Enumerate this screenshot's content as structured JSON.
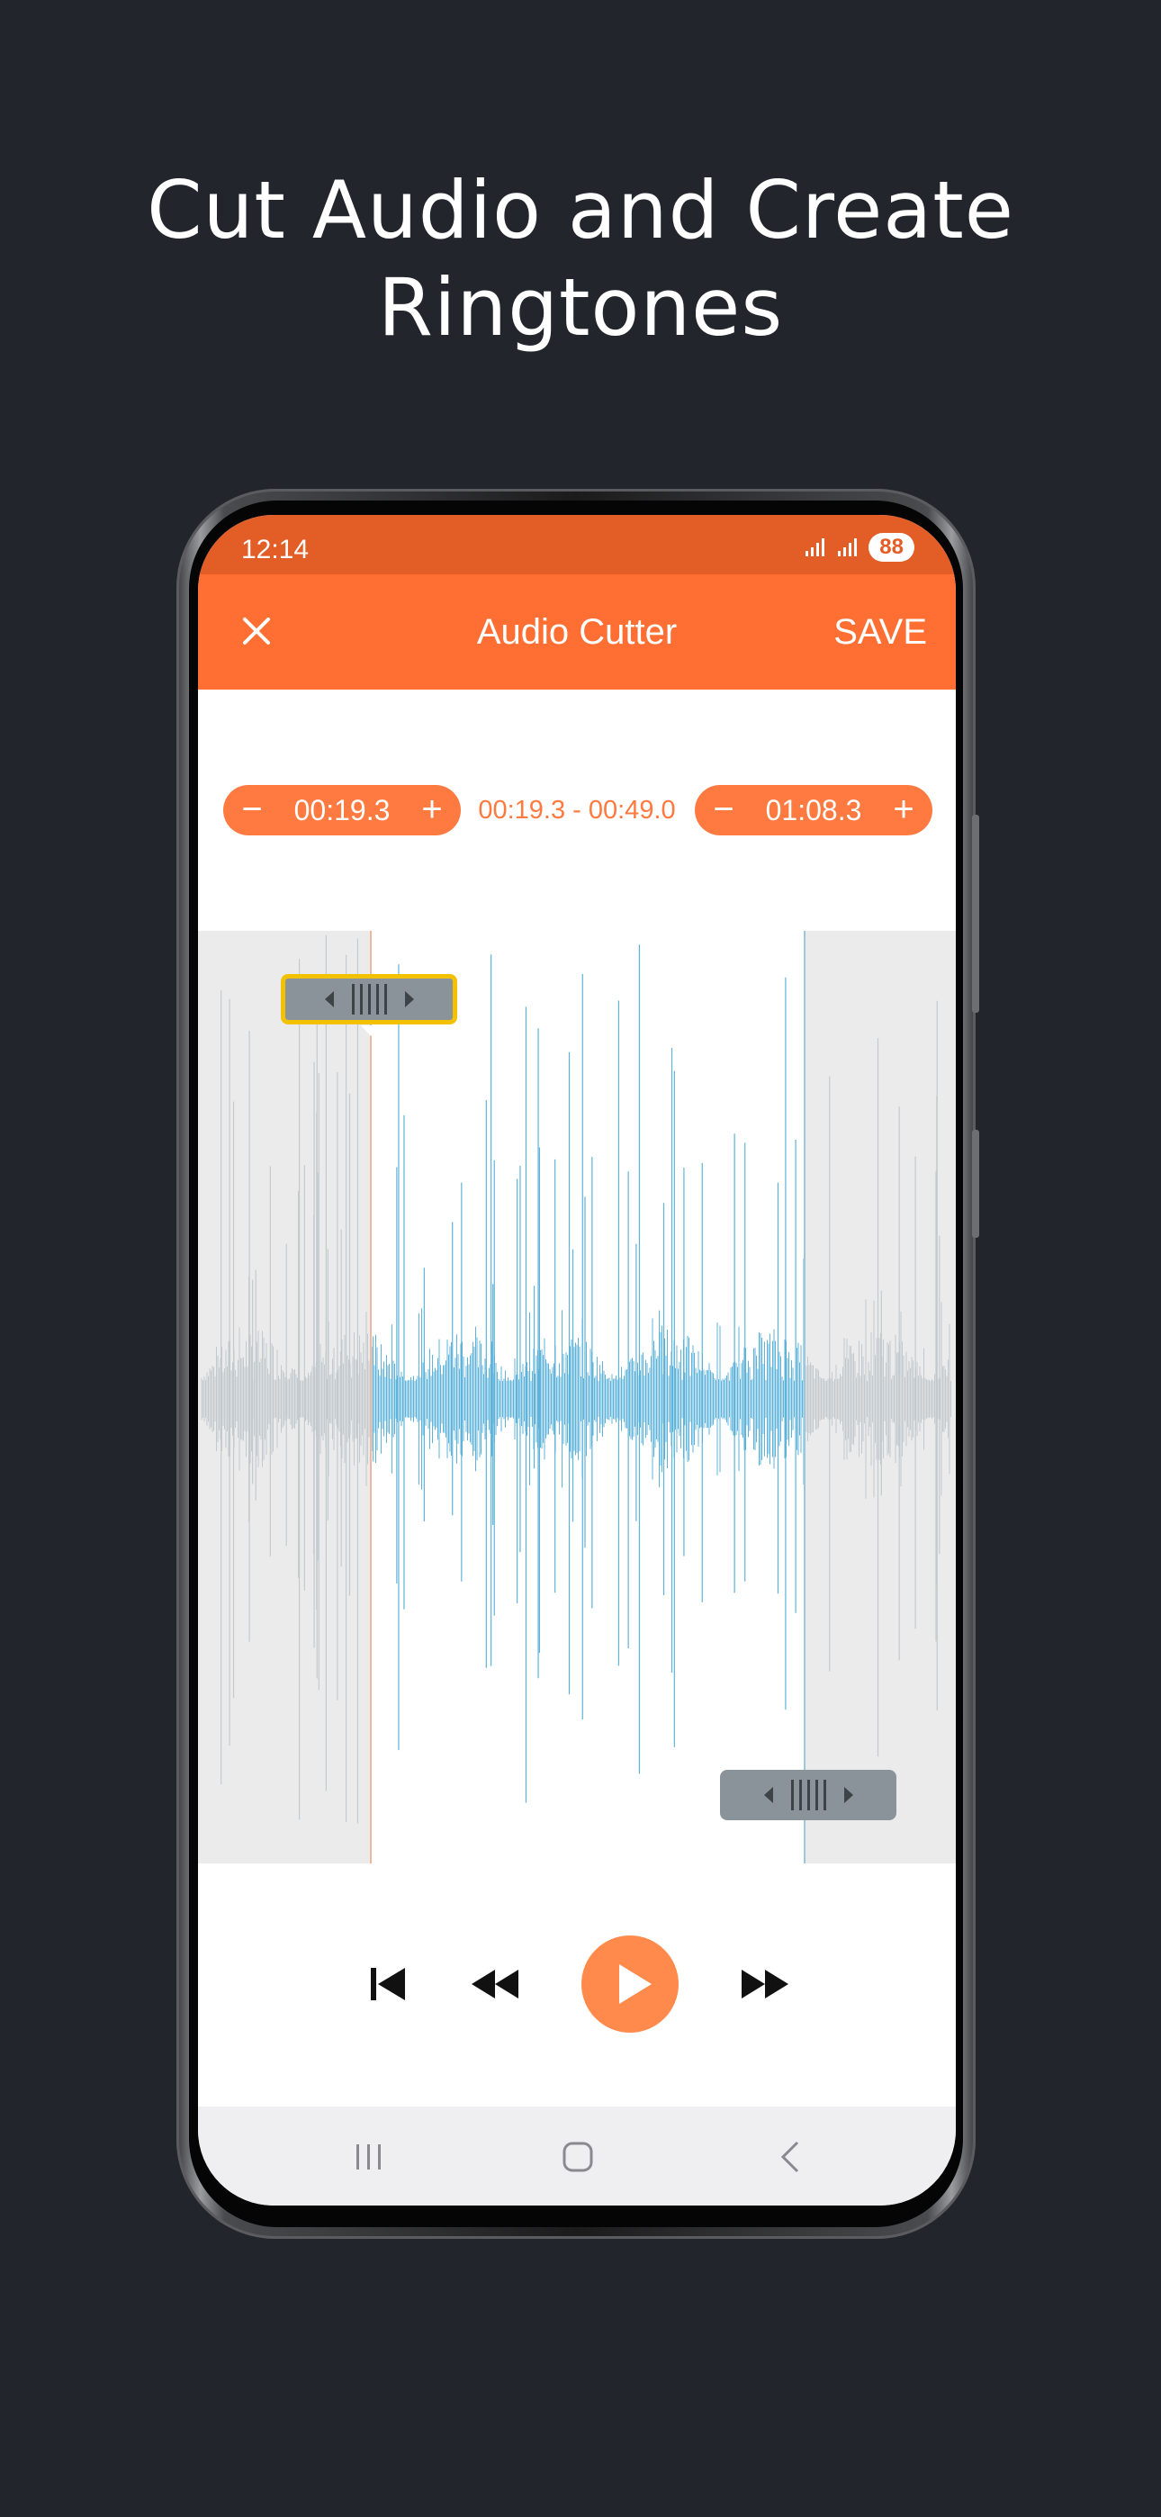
{
  "headline": {
    "line1": "Cut Audio and Create",
    "line2": "Ringtones"
  },
  "status_bar": {
    "time": "12:14",
    "battery": "88"
  },
  "app_bar": {
    "title": "Audio Cutter",
    "save_label": "SAVE",
    "close_icon": "close-icon"
  },
  "trim": {
    "start_value": "00:19.3",
    "end_value": "01:08.3",
    "range_text": "00:19.3 - 00:49.0",
    "minus_label": "−",
    "plus_label": "+"
  },
  "colors": {
    "accent": "#ff6f33",
    "accent_dark": "#e35d27",
    "waveform_active": "#5fb3d9",
    "waveform_inactive": "#b7c4cc",
    "handle_highlight": "#f2c200",
    "background": "#22252c"
  },
  "controls": [
    "skip-previous-icon",
    "rewind-icon",
    "play-icon",
    "fast-forward-icon"
  ],
  "nav": [
    "recent-apps-icon",
    "home-icon",
    "back-icon"
  ]
}
